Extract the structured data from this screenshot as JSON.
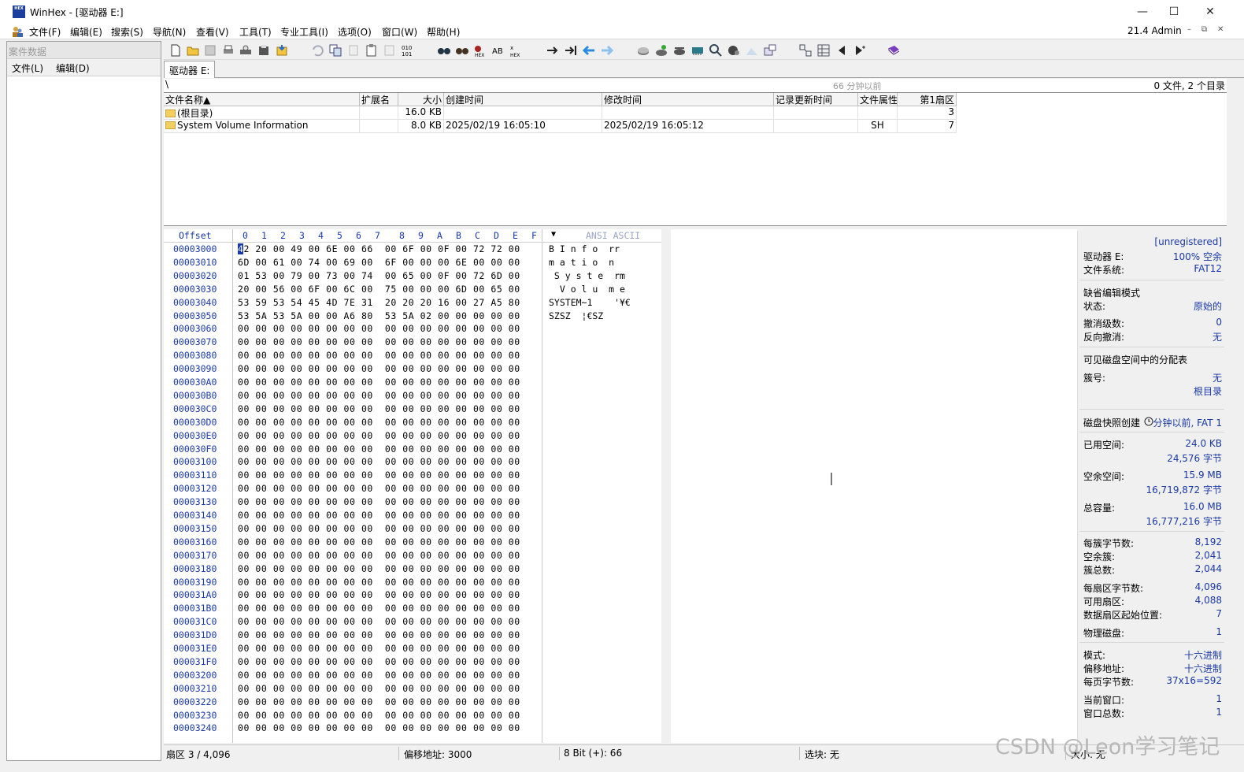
{
  "window": {
    "title": "WinHex - [驱动器 E:]",
    "icon_label": "HEX",
    "btn_minimize": "—",
    "btn_maximize": "☐",
    "btn_close": "✕"
  },
  "menubar": {
    "items": [
      "文件(F)",
      "编辑(E)",
      "搜索(S)",
      "导航(N)",
      "查看(V)",
      "工具(T)",
      "专业工具(I)",
      "选项(O)",
      "窗口(W)",
      "帮助(H)"
    ],
    "admin": "21.4 Admin",
    "mdi_min": "–",
    "mdi_restore": "⧉",
    "mdi_close": "✕"
  },
  "left_panel": {
    "header": "案件数据",
    "menu": [
      "文件(L)",
      "编辑(D)"
    ]
  },
  "toolbar": {
    "icons": [
      "new-file-icon",
      "open-folder-icon",
      "save-icon",
      "print-icon",
      "properties-icon",
      "open-disk-icon",
      "undo-icon",
      "copy-icon",
      "cut-icon",
      "paste-icon",
      "clipboard-icon",
      "binary-icon",
      "find-icon",
      "find-next-icon",
      "find-hex-icon",
      "replace-icon",
      "replace-hex-icon",
      "goto-icon",
      "goto-offset-icon",
      "back-icon",
      "forward-icon",
      "disk-icon",
      "disk-edit-icon",
      "disk-clone-icon",
      "calculator-icon",
      "search-icon",
      "view-icon",
      "analysis-icon",
      "hash-icon",
      "grid-icon",
      "template-icon",
      "prev-icon",
      "next-icon",
      "help-icon"
    ]
  },
  "tab": {
    "label": "驱动器 E:"
  },
  "pathbar": {
    "path": "\\",
    "snapshot": "66 分钟以前",
    "file_count": "0 文件, 2 个目录"
  },
  "file_table": {
    "headers": [
      "文件名称▲",
      "扩展名",
      "大小",
      "创建时间",
      "修改时间",
      "记录更新时间",
      "文件属性",
      "第1扇区"
    ],
    "rows": [
      {
        "name": "(根目录)",
        "ext": "",
        "size": "16.0 KB",
        "created": "",
        "modified": "",
        "updated": "",
        "attr": "",
        "sector": "3"
      },
      {
        "name": "System Volume Information",
        "ext": "",
        "size": "8.0 KB",
        "created": "2025/02/19  16:05:10",
        "modified": "2025/02/19  16:05:12",
        "updated": "",
        "attr": "SH",
        "sector": "7"
      }
    ]
  },
  "hex": {
    "offset_label": "Offset",
    "col_headers": [
      "0",
      "1",
      "2",
      "3",
      "4",
      "5",
      "6",
      "7",
      "8",
      "9",
      "A",
      "B",
      "C",
      "D",
      "E",
      "F"
    ],
    "ascii_header": "ANSI ASCII",
    "dropdown": "▼",
    "offsets": [
      "00003000",
      "00003010",
      "00003020",
      "00003030",
      "00003040",
      "00003050",
      "00003060",
      "00003070",
      "00003080",
      "00003090",
      "000030A0",
      "000030B0",
      "000030C0",
      "000030D0",
      "000030E0",
      "000030F0",
      "00003100",
      "00003110",
      "00003120",
      "00003130",
      "00003140",
      "00003150",
      "00003160",
      "00003170",
      "00003180",
      "00003190",
      "000031A0",
      "000031B0",
      "000031C0",
      "000031D0",
      "000031E0",
      "000031F0",
      "00003200",
      "00003210",
      "00003220",
      "00003230",
      "00003240"
    ],
    "rows": [
      "42 20 00 49 00 6E 00 66  00 6F 00 0F 00 72 72 00",
      "6D 00 61 00 74 00 69 00  6F 00 00 00 6E 00 00 00",
      "01 53 00 79 00 73 00 74  00 65 00 0F 00 72 6D 00",
      "20 00 56 00 6F 00 6C 00  75 00 00 00 6D 00 65 00",
      "53 59 53 54 45 4D 7E 31  20 20 20 16 00 27 A5 80",
      "53 5A 53 5A 00 00 A6 80  53 5A 02 00 00 00 00 00",
      "00 00 00 00 00 00 00 00  00 00 00 00 00 00 00 00",
      "00 00 00 00 00 00 00 00  00 00 00 00 00 00 00 00",
      "00 00 00 00 00 00 00 00  00 00 00 00 00 00 00 00",
      "00 00 00 00 00 00 00 00  00 00 00 00 00 00 00 00",
      "00 00 00 00 00 00 00 00  00 00 00 00 00 00 00 00",
      "00 00 00 00 00 00 00 00  00 00 00 00 00 00 00 00",
      "00 00 00 00 00 00 00 00  00 00 00 00 00 00 00 00",
      "00 00 00 00 00 00 00 00  00 00 00 00 00 00 00 00",
      "00 00 00 00 00 00 00 00  00 00 00 00 00 00 00 00",
      "00 00 00 00 00 00 00 00  00 00 00 00 00 00 00 00",
      "00 00 00 00 00 00 00 00  00 00 00 00 00 00 00 00",
      "00 00 00 00 00 00 00 00  00 00 00 00 00 00 00 00",
      "00 00 00 00 00 00 00 00  00 00 00 00 00 00 00 00",
      "00 00 00 00 00 00 00 00  00 00 00 00 00 00 00 00",
      "00 00 00 00 00 00 00 00  00 00 00 00 00 00 00 00",
      "00 00 00 00 00 00 00 00  00 00 00 00 00 00 00 00",
      "00 00 00 00 00 00 00 00  00 00 00 00 00 00 00 00",
      "00 00 00 00 00 00 00 00  00 00 00 00 00 00 00 00",
      "00 00 00 00 00 00 00 00  00 00 00 00 00 00 00 00",
      "00 00 00 00 00 00 00 00  00 00 00 00 00 00 00 00",
      "00 00 00 00 00 00 00 00  00 00 00 00 00 00 00 00",
      "00 00 00 00 00 00 00 00  00 00 00 00 00 00 00 00",
      "00 00 00 00 00 00 00 00  00 00 00 00 00 00 00 00",
      "00 00 00 00 00 00 00 00  00 00 00 00 00 00 00 00",
      "00 00 00 00 00 00 00 00  00 00 00 00 00 00 00 00",
      "00 00 00 00 00 00 00 00  00 00 00 00 00 00 00 00",
      "00 00 00 00 00 00 00 00  00 00 00 00 00 00 00 00",
      "00 00 00 00 00 00 00 00  00 00 00 00 00 00 00 00",
      "00 00 00 00 00 00 00 00  00 00 00 00 00 00 00 00",
      "00 00 00 00 00 00 00 00  00 00 00 00 00 00 00 00",
      "00 00 00 00 00 00 00 00  00 00 00 00 00 00 00 00"
    ],
    "ascii": [
      "B I n f o  rr",
      "m a t i o  n",
      " S y s t e  rm",
      "  V o l u  m e",
      "SYSTEM~1    '¥€",
      "SZSZ  ¦€SZ"
    ]
  },
  "info": {
    "unregistered": "[unregistered]",
    "drive_label": "驱动器 E:",
    "drive_value": "100% 空余",
    "fs_label": "文件系统:",
    "fs_value": "FAT12",
    "edit_mode": "缺省编辑模式",
    "state_label": "状态:",
    "state_value": "原始的",
    "undo_label": "撤消级数:",
    "undo_value": "0",
    "redo_label": "反向撤消:",
    "redo_value": "无",
    "alloc_title": "可见磁盘空间中的分配表",
    "cluster_label": "簇号:",
    "cluster_value": "无",
    "cluster_value2": "根目录",
    "snapshot_label": "磁盘快照创建",
    "snapshot_value": "分钟以前, FAT 1",
    "used_label": "已用空间:",
    "used_value": "24.0 KB",
    "used_bytes": "24,576 字节",
    "free_label": "空余空间:",
    "free_value": "15.9 MB",
    "free_bytes": "16,719,872 字节",
    "total_label": "总容量:",
    "total_value": "16.0 MB",
    "total_bytes": "16,777,216 字节",
    "bpc_label": "每簇字节数:",
    "bpc_value": "8,192",
    "freec_label": "空余簇:",
    "freec_value": "2,041",
    "totalc_label": "簇总数:",
    "totalc_value": "2,044",
    "bps_label": "每扇区字节数:",
    "bps_value": "4,096",
    "avs_label": "可用扇区:",
    "avs_value": "4,088",
    "dss_label": "数据扇区起始位置:",
    "dss_value": "7",
    "phys_label": "物理磁盘:",
    "phys_value": "1",
    "mode_label": "模式:",
    "mode_value": "十六进制",
    "offaddr_label": "偏移地址:",
    "offaddr_value": "十六进制",
    "bpp_label": "每页字节数:",
    "bpp_value": "37x16=592",
    "curwin_label": "当前窗口:",
    "curwin_value": "1",
    "totwin_label": "窗口总数:",
    "totwin_value": "1"
  },
  "status": {
    "sector": "扇区 3 / 4,096",
    "offset": "偏移地址: 3000",
    "bit": "8 Bit (+): 66",
    "selection": "选块: 无",
    "size": "大小: 无"
  },
  "watermark": "CSDN @Leon学习笔记"
}
